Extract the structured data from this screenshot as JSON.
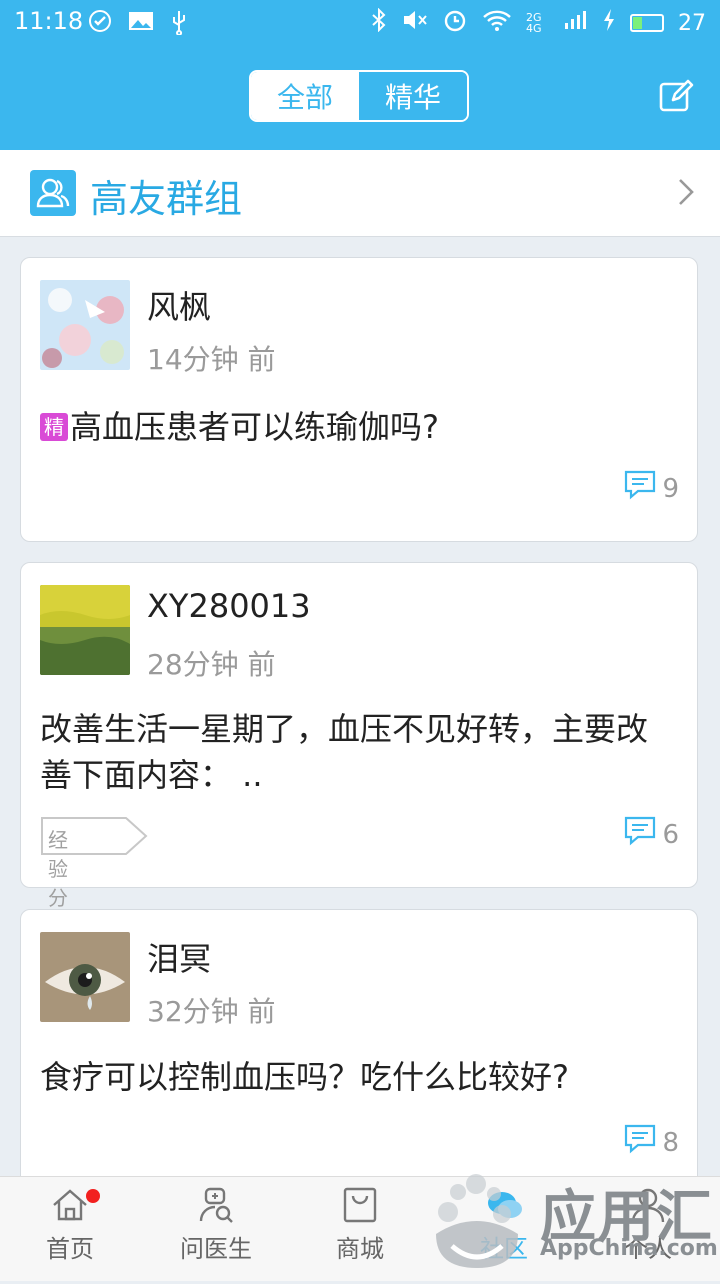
{
  "status_bar": {
    "time": "11:18",
    "battery_level": "27",
    "network_label": "2G 4G"
  },
  "header": {
    "tabs": [
      {
        "label": "全部",
        "active": true
      },
      {
        "label": "精华",
        "active": false
      }
    ],
    "edit_icon": "edit-icon"
  },
  "group": {
    "title": "高友群组"
  },
  "posts": [
    {
      "username": "风枫",
      "time": "14分钟 前",
      "badge": "精",
      "content": "高血压患者可以练瑜伽吗?",
      "comments": "9"
    },
    {
      "username": "XY280013",
      "time": "28分钟 前",
      "content": "改善生活一星期了，血压不见好转，主要改善下面内容： ..",
      "tag": "经验分享",
      "comments": "6"
    },
    {
      "username": "泪冥",
      "time": "32分钟 前",
      "content": "食疗可以控制血压吗？吃什么比较好?",
      "comments": "8"
    }
  ],
  "bottom_nav": [
    {
      "label": "首页",
      "icon": "home-icon",
      "has_dot": true
    },
    {
      "label": "问医生",
      "icon": "doctor-icon"
    },
    {
      "label": "商城",
      "icon": "shop-bag-icon"
    },
    {
      "label": "社区",
      "icon": "community-icon"
    },
    {
      "label": "个人",
      "icon": "person-icon"
    }
  ],
  "watermark": {
    "text": "应用汇",
    "sub": "AppChina.com"
  },
  "colors": {
    "brand": "#3bb7ee",
    "badge": "#d94ad6",
    "notification": "#f2201f"
  }
}
